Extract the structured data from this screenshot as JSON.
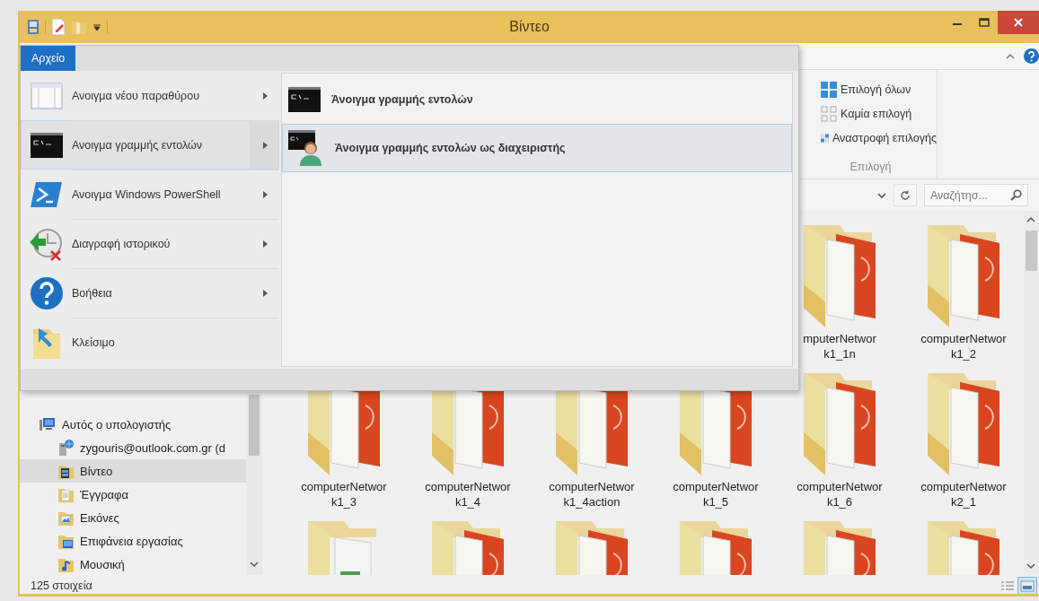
{
  "window": {
    "title": "Βίντεο"
  },
  "file_menu": {
    "tab": "Αρχείο",
    "items": [
      {
        "label": "Ανοιγμα νέου παραθύρου",
        "kind": "window",
        "has_submenu": true,
        "selected": false
      },
      {
        "label": "Ανοιγμα γραμμής εντολών",
        "kind": "cmd",
        "has_submenu": true,
        "selected": true
      },
      {
        "label": "Ανοιγμα Windows PowerShell",
        "kind": "powershell",
        "has_submenu": true,
        "selected": false
      },
      {
        "label": "Διαγραφή ιστορικού",
        "kind": "history",
        "has_submenu": true,
        "selected": false
      },
      {
        "label": "Βοήθεια",
        "kind": "help",
        "has_submenu": true,
        "selected": false
      },
      {
        "label": "Κλείσιμο",
        "kind": "close",
        "has_submenu": false,
        "selected": false
      }
    ],
    "submenu": [
      {
        "label": "Άνοιγμα γραμμής εντολών",
        "kind": "cmd",
        "selected": false
      },
      {
        "label": "Άνοιγμα γραμμής εντολών ως διαχειριστής",
        "kind": "cmd-admin",
        "selected": true
      }
    ]
  },
  "ribbon": {
    "select_group": {
      "title": "Επιλογή",
      "buttons": [
        {
          "label": "Επιλογή όλων",
          "kind": "select-all"
        },
        {
          "label": "Καμία επιλογή",
          "kind": "select-none"
        },
        {
          "label": "Αναστροφή επιλογής",
          "kind": "invert"
        }
      ]
    }
  },
  "address_bar": {
    "search": {
      "placeholder": "Αναζήτησ..."
    }
  },
  "navigation": {
    "items": [
      {
        "label": "Αυτός ο υπολογιστής",
        "kind": "computer",
        "selected": false,
        "children": [
          {
            "label": "zygouris@outlook.com.gr (d",
            "kind": "network",
            "selected": false
          },
          {
            "label": "Βίντεο",
            "kind": "videos",
            "selected": true
          },
          {
            "label": "Έγγραφα",
            "kind": "documents",
            "selected": false
          },
          {
            "label": "Εικόνες",
            "kind": "pictures",
            "selected": false
          },
          {
            "label": "Επιφάνεια εργασίας",
            "kind": "desktop",
            "selected": false
          },
          {
            "label": "Μουσική",
            "kind": "music",
            "selected": false
          }
        ]
      }
    ]
  },
  "files": {
    "rows": [
      [
        "",
        "",
        "",
        "",
        {
          "label": [
            "mputerNetwor",
            "k1_1n"
          ],
          "kind": "video"
        },
        {
          "label": [
            "computerNetwor",
            "k1_2"
          ],
          "kind": "video"
        }
      ],
      [
        {
          "label": [
            "computerNetwor",
            "k1_3"
          ],
          "kind": "video"
        },
        {
          "label": [
            "computerNetwor",
            "k1_4"
          ],
          "kind": "video"
        },
        {
          "label": [
            "computerNetwor",
            "k1_4action"
          ],
          "kind": "video"
        },
        {
          "label": [
            "computerNetwor",
            "k1_5"
          ],
          "kind": "video"
        },
        {
          "label": [
            "computerNetwor",
            "k1_6"
          ],
          "kind": "video"
        },
        {
          "label": [
            "computerNetwor",
            "k2_1"
          ],
          "kind": "video"
        }
      ],
      [
        {
          "kind": "document"
        },
        {
          "kind": "video"
        },
        {
          "kind": "video"
        },
        {
          "kind": "video"
        },
        {
          "kind": "video"
        },
        {
          "kind": "video"
        }
      ]
    ]
  },
  "status_bar": {
    "count": "125 στοιχεία",
    "views": [
      {
        "kind": "details",
        "selected": false
      },
      {
        "kind": "large-icons",
        "selected": true
      }
    ]
  }
}
